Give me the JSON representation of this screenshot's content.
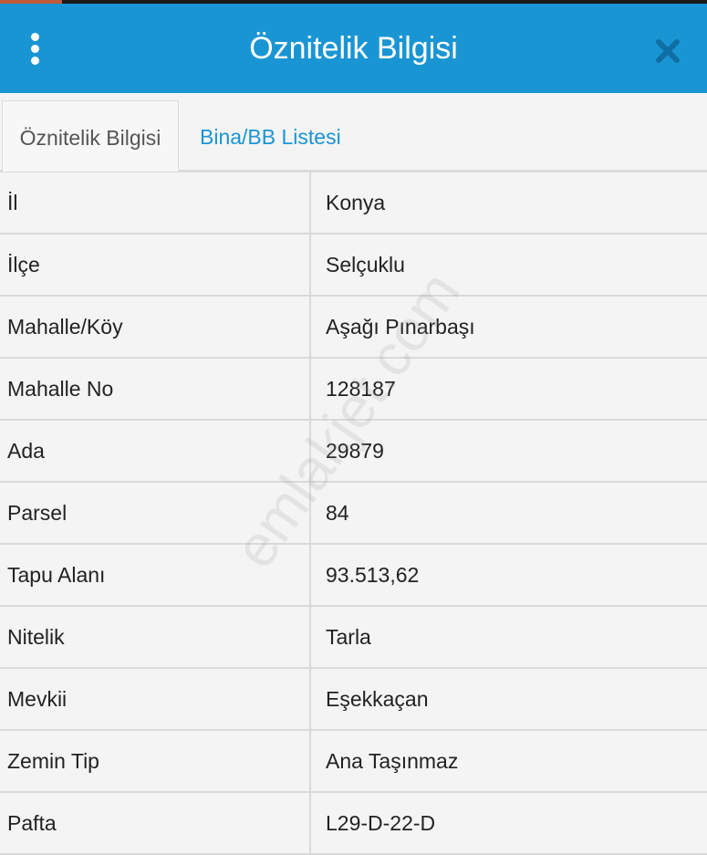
{
  "header": {
    "title": "Öznitelik Bilgisi",
    "menu_icon": "kebab-menu-icon",
    "close_icon": "close-icon",
    "background": "#1a95d3"
  },
  "tabs": [
    {
      "label": "Öznitelik Bilgisi",
      "active": true
    },
    {
      "label": "Bina/BB Listesi",
      "active": false
    }
  ],
  "attributes": {
    "columns": [
      "label",
      "value"
    ],
    "rows": [
      {
        "label": "İl",
        "value": "Konya"
      },
      {
        "label": "İlçe",
        "value": "Selçuklu"
      },
      {
        "label": "Mahalle/Köy",
        "value": "Aşağı Pınarbaşı"
      },
      {
        "label": "Mahalle No",
        "value": "128187"
      },
      {
        "label": "Ada",
        "value": "29879"
      },
      {
        "label": "Parsel",
        "value": "84"
      },
      {
        "label": "Tapu Alanı",
        "value": "93.513,62"
      },
      {
        "label": "Nitelik",
        "value": "Tarla"
      },
      {
        "label": "Mevkii",
        "value": "Eşekkaçan"
      },
      {
        "label": "Zemin Tip",
        "value": "Ana Taşınmaz"
      },
      {
        "label": "Pafta",
        "value": "L29-D-22-D"
      }
    ]
  },
  "watermark": "emlakjet.com"
}
